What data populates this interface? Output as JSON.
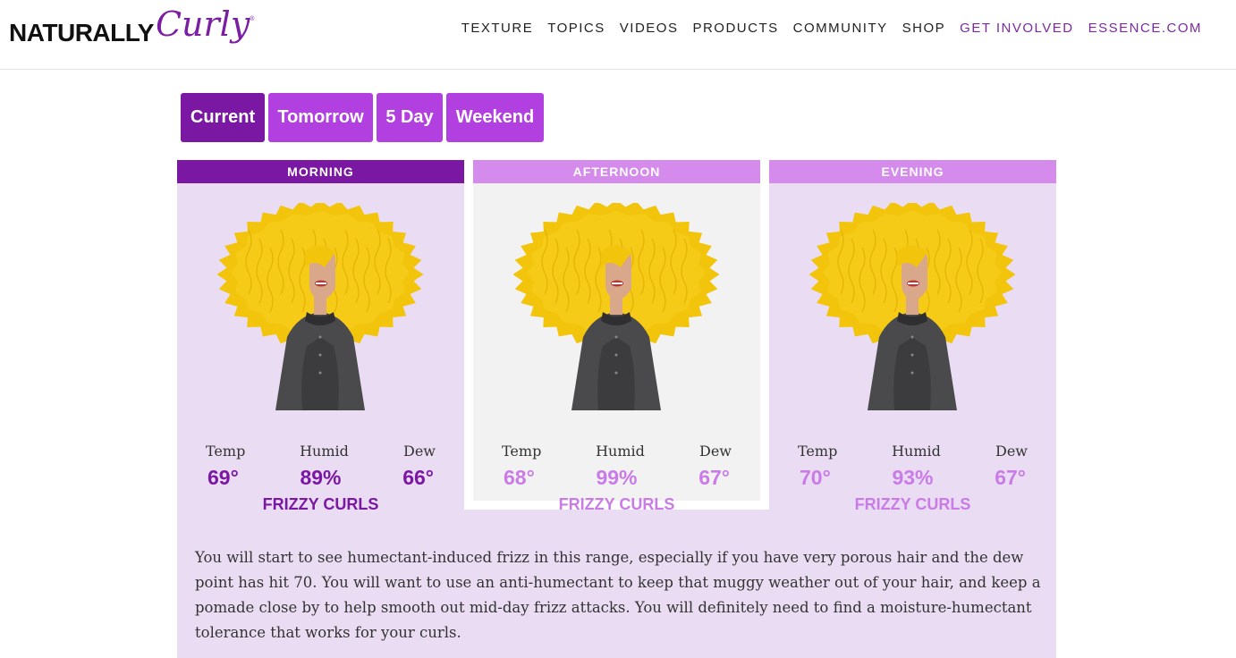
{
  "header": {
    "logo_main": "NATURALLY",
    "logo_script": "Curly",
    "logo_reg": "®",
    "nav": [
      "TEXTURE",
      "TOPICS",
      "VIDEOS",
      "PRODUCTS",
      "COMMUNITY",
      "SHOP",
      "GET INVOLVED",
      "ESSENCE.COM"
    ]
  },
  "tabs": [
    "Current",
    "Tomorrow",
    "5 Day",
    "Weekend"
  ],
  "active_tab": "Current",
  "cards": [
    {
      "title": "MORNING",
      "labels": [
        "Temp",
        "Humid",
        "Dew"
      ],
      "temp": "69°",
      "humid": "89%",
      "dew": "66°",
      "condition": "FRIZZY CURLS"
    },
    {
      "title": "AFTERNOON",
      "labels": [
        "Temp",
        "Humid",
        "Dew"
      ],
      "temp": "68°",
      "humid": "99%",
      "dew": "67°",
      "condition": "FRIZZY CURLS"
    },
    {
      "title": "EVENING",
      "labels": [
        "Temp",
        "Humid",
        "Dew"
      ],
      "temp": "70°",
      "humid": "93%",
      "dew": "67°",
      "condition": "FRIZZY CURLS"
    }
  ],
  "description": "You will start to see humectant-induced frizz in this range, especially if you have very porous hair and the dew point has hit 70. You will want to use an anti-humectant to keep that muggy weather out of your hair, and keep a pomade close by to help smooth out mid-day frizz attacks. You will definitely need to find a moisture-humectant tolerance that works for your curls.",
  "colors": {
    "brand_purple": "#7a18a4",
    "tab_purple": "#b23fe0",
    "light_header": "#d58bec",
    "light_value": "#c97ce6",
    "card_light_bg": "#eadcf2",
    "card_grey_bg": "#f2f2f2",
    "hair": "#f2c40c"
  }
}
